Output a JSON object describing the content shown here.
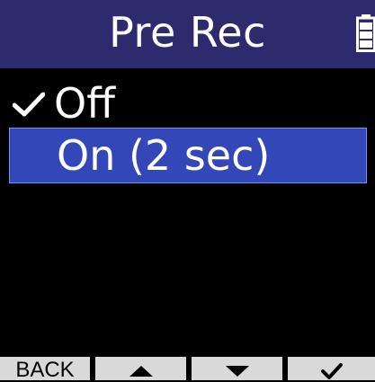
{
  "header": {
    "title": "Pre Rec",
    "battery_icon": "battery-icon"
  },
  "menu": {
    "items": [
      {
        "label": "Off",
        "checked": true,
        "selected": false
      },
      {
        "label": "On (2 sec)",
        "checked": false,
        "selected": true
      }
    ]
  },
  "softkeys": {
    "back_label": "BACK",
    "up_icon": "triangle-up-icon",
    "down_icon": "triangle-down-icon",
    "enter_icon": "check-icon"
  },
  "colors": {
    "title_bar": "#2e2a6e",
    "selection": "#3347b8",
    "background": "#000000",
    "softkey": "#d9d9d9"
  }
}
